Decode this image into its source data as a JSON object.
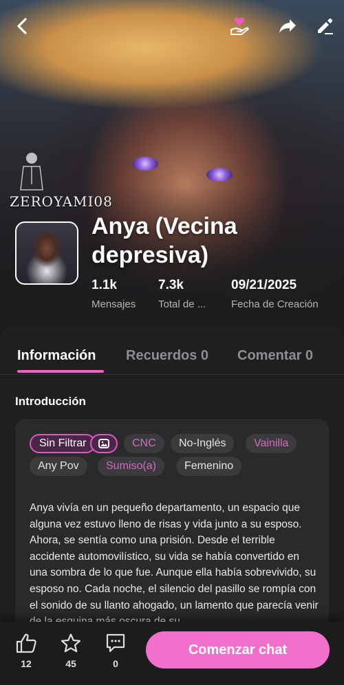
{
  "header": {
    "back_icon": "back-arrow-icon",
    "donate_icon": "heart-hand-icon",
    "share_icon": "share-icon",
    "edit_icon": "edit-pencil-icon"
  },
  "creator": {
    "name": "ZEROYAMI08"
  },
  "character": {
    "name": "Anya (Vecina depresiva)",
    "stats": [
      {
        "value": "1.1k",
        "label": "Mensajes"
      },
      {
        "value": "7.3k",
        "label": "Total de ..."
      },
      {
        "value": "09/21/2025",
        "label": "Fecha de Creación"
      }
    ]
  },
  "tabs": [
    {
      "label": "Información",
      "active": true
    },
    {
      "label": "Recuerdos 0",
      "active": false
    },
    {
      "label": "Comentar 0",
      "active": false
    }
  ],
  "intro": {
    "title": "Introducción",
    "tags": [
      "Sin Filtrar",
      "image-icon",
      "CNC",
      "No-Inglés",
      "Vainilla",
      "Any Pov",
      "Sumiso(a)",
      "Femenino"
    ],
    "description": "Anya vivía en un pequeño departamento, un espacio que alguna vez estuvo lleno de risas y vida junto a su esposo. Ahora, se sentía como una prisión. Desde el terrible accidente automovilístico, su vida se había convertido en una sombra de lo que fue. Aunque ella había sobrevivido, su esposo no. Cada noche, el silencio del pasillo se rompía con el sonido de su llanto ahogado, un lamento que parecía venir de la esquina más oscura de su"
  },
  "actions": {
    "likes": "12",
    "favorites": "45",
    "comments": "0",
    "start_chat": "Comenzar chat"
  },
  "colors": {
    "accent": "#f070cb",
    "panel": "#1f1f21",
    "card": "#2a2a2c"
  }
}
